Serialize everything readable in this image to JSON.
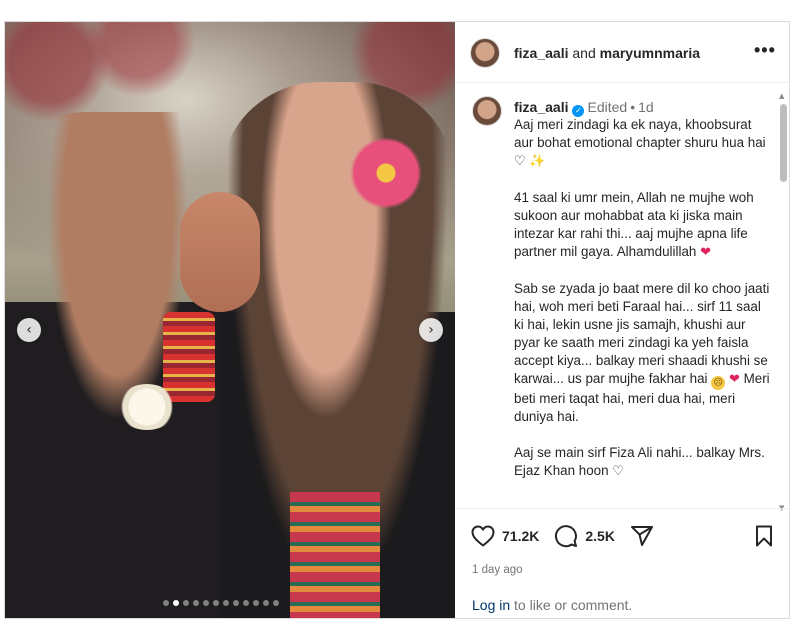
{
  "header": {
    "user1": "fiza_aali",
    "connector": "and",
    "user2": "maryumnmaria",
    "more_icon": "•••"
  },
  "media": {
    "prev_icon": "‹",
    "next_icon": "›",
    "carousel_total": 12,
    "carousel_active_index": 1
  },
  "caption": {
    "username": "fiza_aali",
    "verified_icon": "✓",
    "edited": "Edited",
    "separator": "•",
    "time": "1d",
    "p1_text": "Aaj meri zindagi ka ek naya, khoobsurat aur bohat emotional chapter shuru hua hai",
    "p1_icon1": "♡",
    "p1_icon2": "✨",
    "p2_text": "41 saal ki umr mein, Allah ne mujhe woh sukoon aur mohabbat ata ki jiska main intezar kar rahi thi... aaj mujhe apna life partner mil gaya. Alhamdulillah",
    "p2_icon": "❤",
    "p3_text": "Sab se zyada jo baat mere dil ko choo jaati hai, woh meri beti Faraal hai... sirf 11 saal ki hai, lekin usne jis samajh, khushi aur pyar ke saath meri zindagi ka yeh faisla accept kiya... balkay meri shaadi khushi se karwai... us par mujhe fakhar hai",
    "p3_icon1": "☹",
    "p3_icon2": "❤",
    "p3_text2": "Meri beti meri taqat hai, meri dua hai, meri duniya hai.",
    "p4_text": "Aaj se main sirf Fiza Ali nahi... balkay Mrs. Ejaz Khan hoon",
    "p4_icon": "♡"
  },
  "scrollbar": {
    "up_icon": "▲",
    "down_icon": "▼"
  },
  "actions": {
    "likes": "71.2K",
    "comments": "2.5K",
    "time_ago": "1 day ago",
    "login_link": "Log in",
    "login_rest": " to like or comment."
  }
}
